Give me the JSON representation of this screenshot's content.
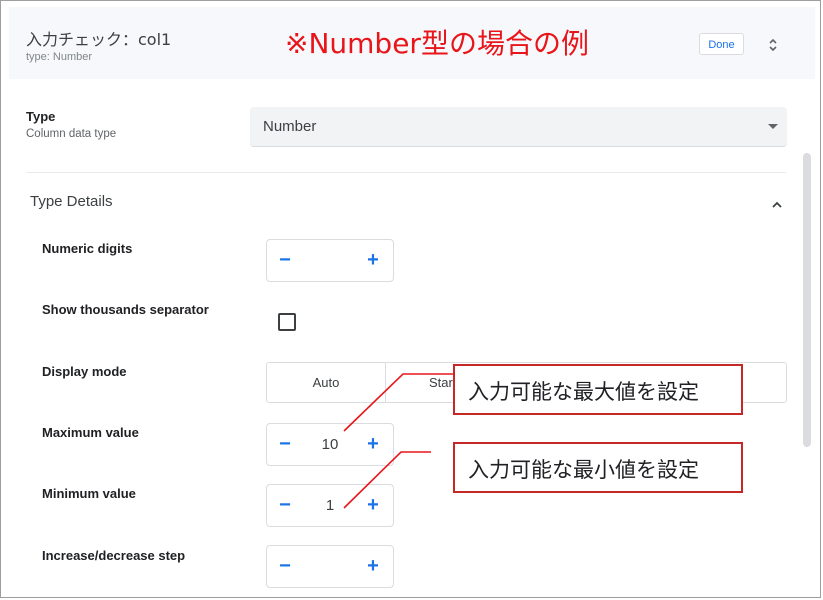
{
  "header": {
    "title": "入力チェック：col1",
    "subtitle": "type: Number",
    "done_label": "Done",
    "annotation": "※Number型の場合の例"
  },
  "type_field": {
    "label": "Type",
    "sublabel": "Column data type",
    "value": "Number"
  },
  "type_details": {
    "title": "Type Details",
    "numeric_digits": {
      "label": "Numeric digits",
      "value": ""
    },
    "show_thousands_separator": {
      "label": "Show thousands separator",
      "checked": false
    },
    "display_mode": {
      "label": "Display mode",
      "options": [
        "Auto",
        "Star"
      ]
    },
    "maximum_value": {
      "label": "Maximum value",
      "value": "10"
    },
    "minimum_value": {
      "label": "Minimum value",
      "value": "1"
    },
    "increase_decrease_step": {
      "label": "Increase/decrease step",
      "value": ""
    }
  },
  "stepper": {
    "minus": "−",
    "plus": "+"
  },
  "callouts": {
    "max": "入力可能な最大値を設定",
    "min": "入力可能な最小値を設定"
  },
  "colors": {
    "accent": "#1a73e8",
    "annotation_red": "#e8161b",
    "callout_border": "#c62828"
  },
  "icons": {
    "sort": "up-down-chevron-icon",
    "collapse": "chevron-up-icon",
    "dropdown": "caret-down-icon"
  }
}
